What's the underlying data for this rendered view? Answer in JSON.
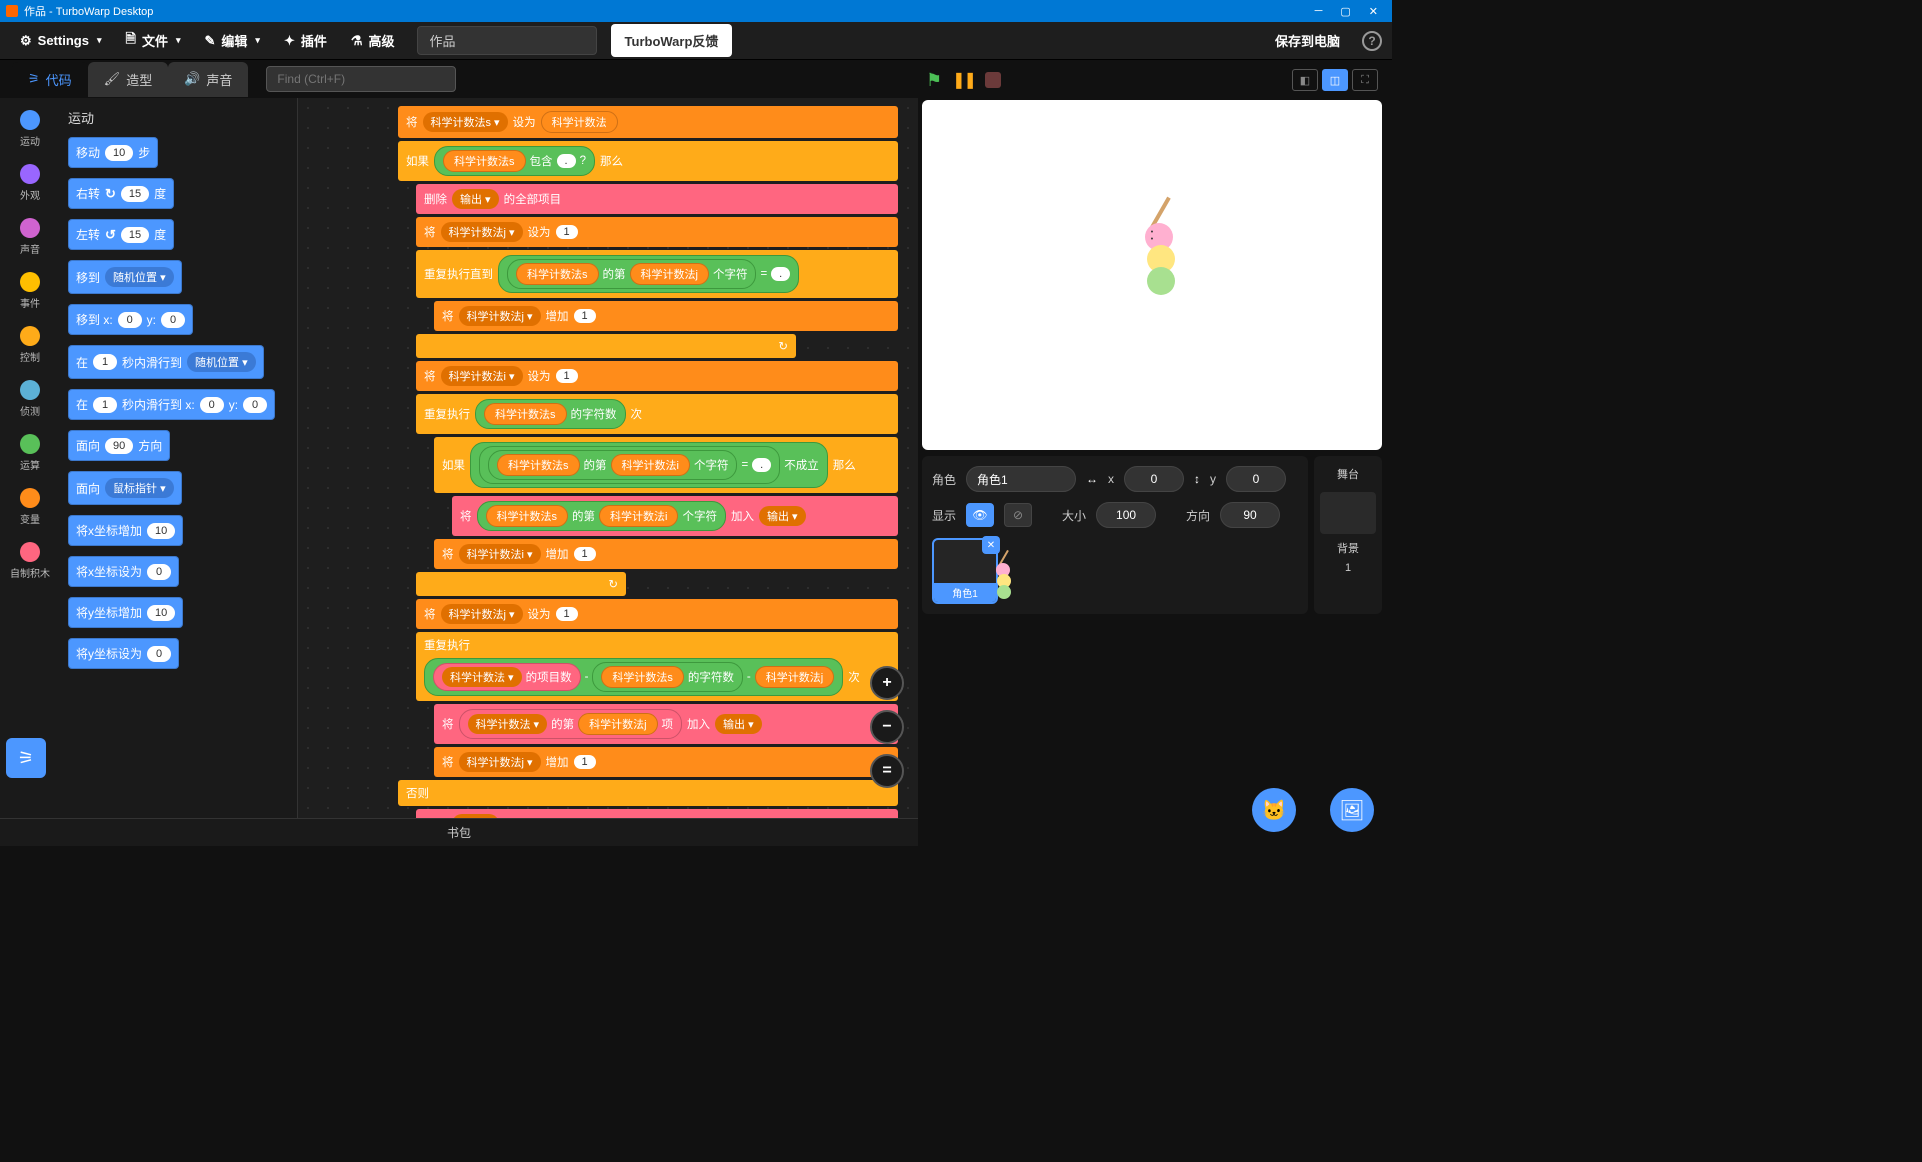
{
  "window_title": "作品 - TurboWarp Desktop",
  "menu": {
    "settings": "Settings",
    "file": "文件",
    "edit": "编辑",
    "addons": "插件",
    "advanced": "高级",
    "project_name": "作品",
    "feedback": "TurboWarp反馈",
    "save": "保存到电脑"
  },
  "tabs": {
    "code": "代码",
    "costumes": "造型",
    "sounds": "声音"
  },
  "find_placeholder": "Find (Ctrl+F)",
  "categories": [
    {
      "name": "运动",
      "color": "#4c97ff"
    },
    {
      "name": "外观",
      "color": "#9966ff"
    },
    {
      "name": "声音",
      "color": "#cf63cf"
    },
    {
      "name": "事件",
      "color": "#ffbf00"
    },
    {
      "name": "控制",
      "color": "#ffab19"
    },
    {
      "name": "侦测",
      "color": "#5cb1d6"
    },
    {
      "name": "运算",
      "color": "#59c059"
    },
    {
      "name": "变量",
      "color": "#ff8c1a"
    },
    {
      "name": "自制积木",
      "color": "#ff6680"
    }
  ],
  "palette_title": "运动",
  "palette": {
    "move_steps": {
      "pre": "移动",
      "arg": "10",
      "post": "步"
    },
    "turn_right": {
      "pre": "右转",
      "icon": "↻",
      "arg": "15",
      "post": "度"
    },
    "turn_left": {
      "pre": "左转",
      "icon": "↺",
      "arg": "15",
      "post": "度"
    },
    "goto": {
      "pre": "移到",
      "dd": "随机位置 ▾"
    },
    "goto_xy": {
      "pre": "移到 x:",
      "x": "0",
      "mid": "y:",
      "y": "0"
    },
    "glide": {
      "pre": "在",
      "s": "1",
      "mid": "秒内滑行到",
      "dd": "随机位置 ▾"
    },
    "glide_xy": {
      "pre": "在",
      "s": "1",
      "mid": "秒内滑行到 x:",
      "x": "0",
      "mid2": "y:",
      "y": "0"
    },
    "point_dir": {
      "pre": "面向",
      "arg": "90",
      "post": "方向"
    },
    "point_towards": {
      "pre": "面向",
      "dd": "鼠标指针 ▾"
    },
    "change_x": {
      "pre": "将x坐标增加",
      "arg": "10"
    },
    "set_x": {
      "pre": "将x坐标设为",
      "arg": "0"
    },
    "change_y": {
      "pre": "将y坐标增加",
      "arg": "10"
    },
    "set_y": {
      "pre": "将y坐标设为",
      "arg": "0"
    }
  },
  "workspace": {
    "var1_dd": "科学计数法s ▾",
    "var2_dd": "科学计数法j ▾",
    "var3_dd": "科学计数法i ▾",
    "var4_dd": "科学计数法 ▾",
    "var_plain1": "科学计数法s",
    "var_plain2": "科学计数法j",
    "var_plain3": "科学计数法i",
    "var_plain4": "科学计数法",
    "output_dd": "输出 ▾",
    "set_to": "设为",
    "set_prefix": "将",
    "if": "如果",
    "then": "那么",
    "else": "否则",
    "contains": "包含",
    "q": "?",
    "dot": ".",
    "delete_all_1": "删除",
    "delete_all_2": "的全部项目",
    "repeat_until": "重复执行直到",
    "repeat": "重复执行",
    "letter_of_1": "的第",
    "letter_of_2": "个字符",
    "equals": "=",
    "change_by": "增加",
    "one": "1",
    "length_of": "的字符数",
    "times": "次",
    "not": "不成立",
    "join_to": "加入",
    "item_count": "的项目数",
    "minus": "-",
    "item_of_1": "的第",
    "item_of_2": "项"
  },
  "backpack": "书包",
  "sprite_info": {
    "label_sprite": "角色",
    "name": "角色1",
    "x_label": "x",
    "x": "0",
    "y_label": "y",
    "y": "0",
    "show_label": "显示",
    "size_label": "大小",
    "size": "100",
    "dir_label": "方向",
    "dir": "90"
  },
  "stage_panel": {
    "title": "舞台",
    "backdrops_label": "背景",
    "backdrops_count": "1"
  }
}
